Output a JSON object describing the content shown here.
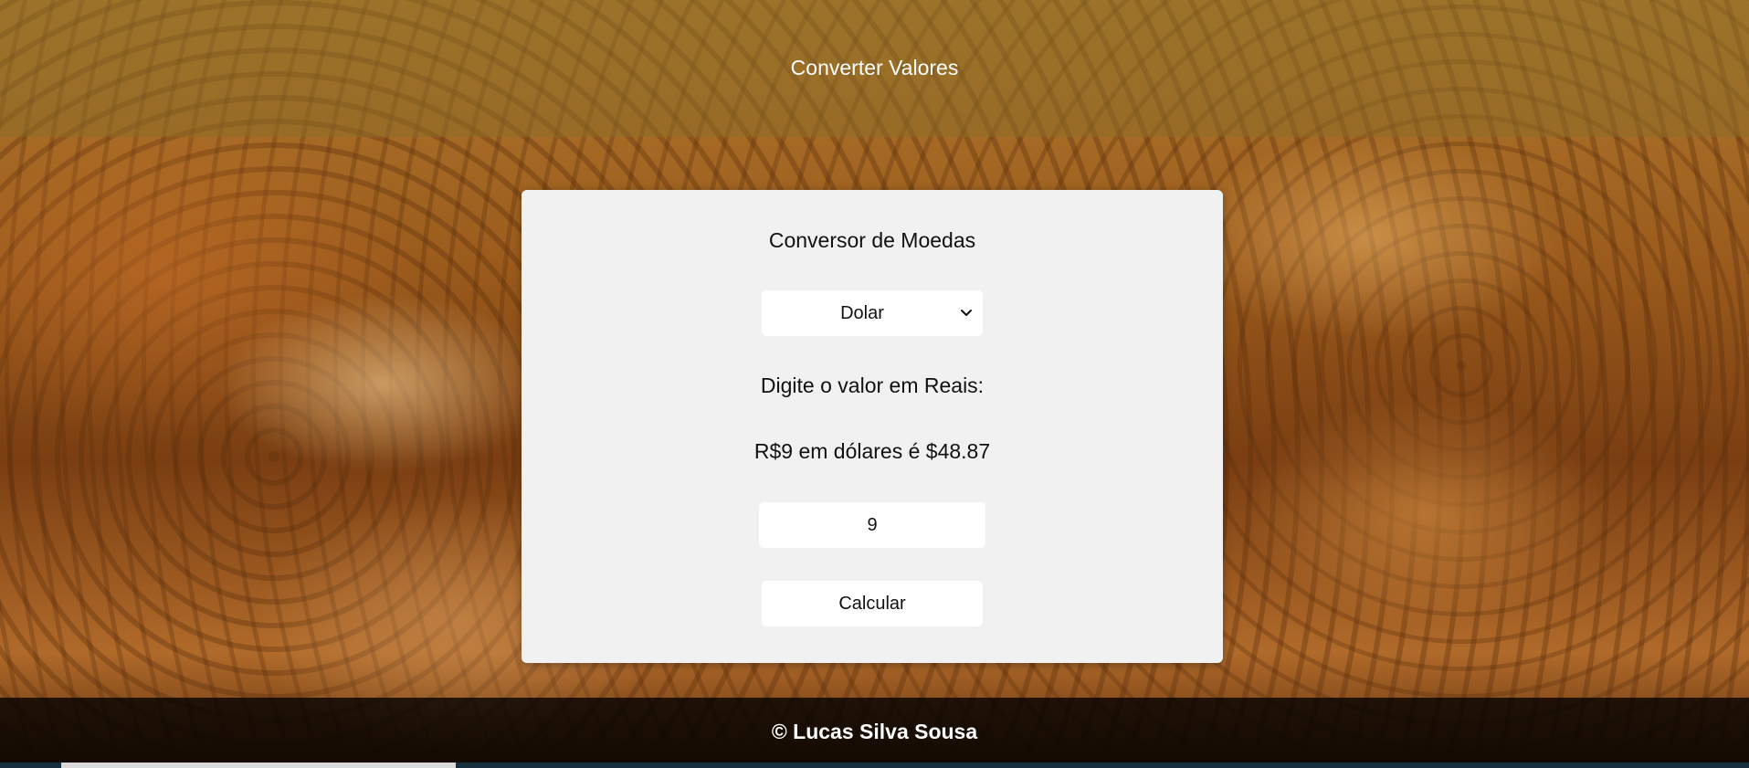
{
  "header": {
    "title": "Converter Valores"
  },
  "converter": {
    "title": "Conversor de Moedas",
    "currency_selected": "Dolar",
    "prompt": "Digite o valor em Reais:",
    "result": "R$9 em dólares é $48.87",
    "amount_value": "9",
    "calculate_label": "Calcular",
    "chevron_icon": "chevron-down-icon"
  },
  "footer": {
    "text": "© Lucas Silva Sousa"
  },
  "colors": {
    "card_background": "#f1f1f1",
    "header_overlay": "#8c6e28",
    "footer_background": "#000000",
    "text": "#111111"
  }
}
